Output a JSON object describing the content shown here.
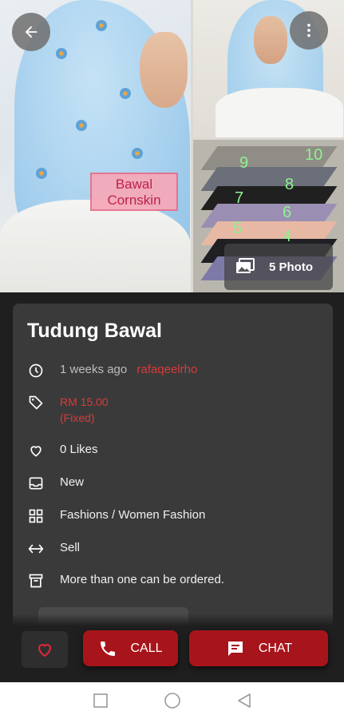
{
  "photos": {
    "brand_tag": "Bawal Cornskin",
    "photo_count_label": "5 Photo",
    "fold_numbers": [
      "9",
      "10",
      "8",
      "7",
      "6",
      "5",
      "4"
    ]
  },
  "listing": {
    "title": "Tudung Bawal",
    "posted_ago": "1 weeks ago",
    "seller": "rafaqeelrho",
    "price": "RM 15.00",
    "price_type": "(Fixed)",
    "likes": "0 Likes",
    "condition": "New",
    "category": "Fashions / Women Fashion",
    "listing_type": "Sell",
    "quantity_note": "More than one can be ordered."
  },
  "actions": {
    "call_label": "CALL",
    "chat_label": "CHAT"
  },
  "icons": [
    "back-arrow-icon",
    "more-vert-icon",
    "photo-gallery-icon",
    "clock-icon",
    "tag-icon",
    "heart-outline-icon",
    "inbox-icon",
    "category-grid-icon",
    "swap-arrows-icon",
    "archive-box-icon",
    "heart-icon",
    "phone-icon",
    "chat-icon",
    "nav-square-icon",
    "nav-circle-icon",
    "nav-back-triangle-icon"
  ],
  "colors": {
    "accent_red": "#a8141b",
    "highlight_red": "#d93a3a",
    "card_bg": "#3a3a3a",
    "page_bg": "#1f1f1f"
  }
}
